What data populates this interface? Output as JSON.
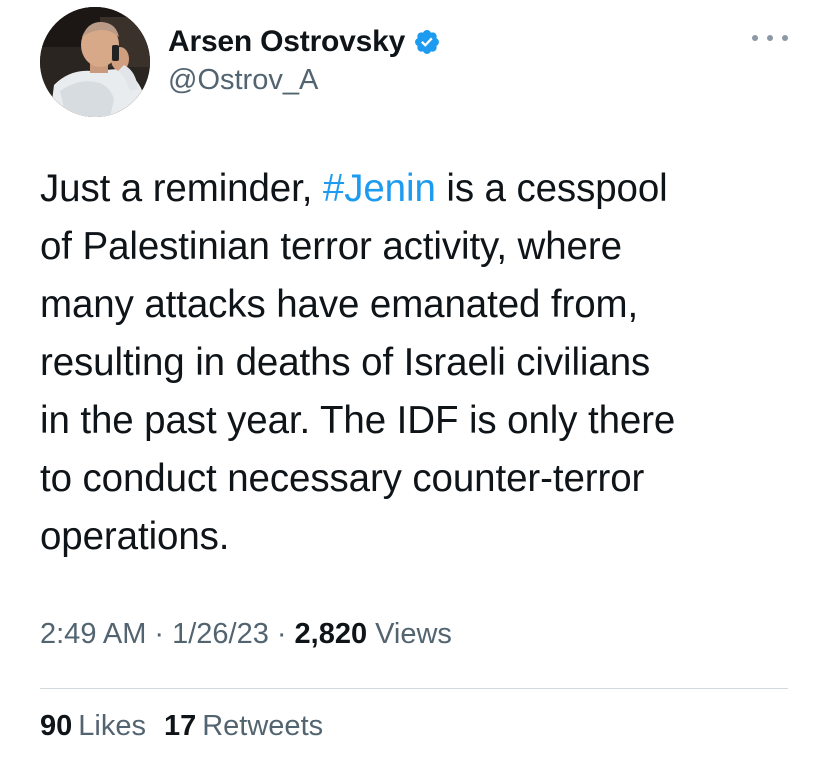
{
  "user": {
    "display_name": "Arsen Ostrovsky",
    "handle": "@Ostrov_A",
    "verified_icon": "verified-badge-icon",
    "avatar_icon": "profile-photo"
  },
  "more_icon": "more-options-icon",
  "tweet": {
    "lines": [
      {
        "pre": "Just a reminder, ",
        "hashtag": "#Jenin",
        "post": " is a cesspool"
      },
      {
        "text": "of Palestinian terror activity, where"
      },
      {
        "text": "many attacks have emanated from,"
      },
      {
        "text": "resulting in deaths of Israeli civilians"
      },
      {
        "text": "in the past year. The IDF is only there"
      },
      {
        "text": "to conduct necessary counter-terror"
      },
      {
        "text": "operations."
      }
    ]
  },
  "meta": {
    "time": "2:49 AM",
    "date": "1/26/23",
    "separator": "·",
    "views_count": "2,820",
    "views_label": "Views"
  },
  "stats": {
    "likes_count": "90",
    "likes_label": "Likes",
    "retweets_count": "17",
    "retweets_label": "Retweets"
  },
  "colors": {
    "text": "#0f1419",
    "secondary": "#536471",
    "link": "#1d9bf0",
    "divider": "#cfd9de"
  }
}
